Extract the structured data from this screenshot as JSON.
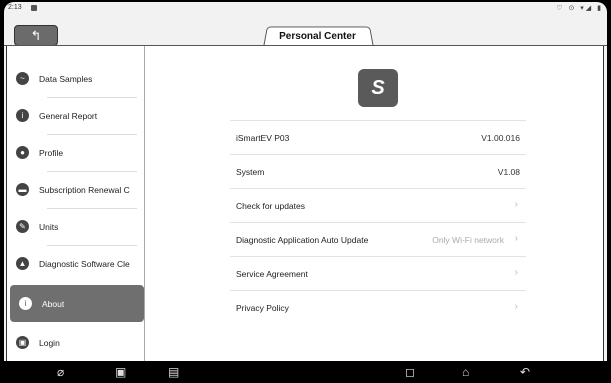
{
  "status": {
    "time": "2:13",
    "icons": "♡ ⊙ ▾◢ ▮"
  },
  "header": {
    "title": "Personal Center",
    "back_icon": "back-arrow-icon"
  },
  "sidebar": {
    "items": [
      {
        "label": "Data Samples",
        "icon": "waveform-icon",
        "active": false
      },
      {
        "label": "General Report",
        "icon": "info-icon",
        "active": false
      },
      {
        "label": "Profile",
        "icon": "user-icon",
        "active": false
      },
      {
        "label": "Subscription Renewal C",
        "icon": "card-icon",
        "active": false
      },
      {
        "label": "Units",
        "icon": "pencil-icon",
        "active": false
      },
      {
        "label": "Diagnostic Software Cle",
        "icon": "clean-icon",
        "active": false
      },
      {
        "label": "About",
        "icon": "info-icon",
        "active": true
      },
      {
        "label": "Login",
        "icon": "login-icon",
        "active": false
      }
    ]
  },
  "about": {
    "logo_letter": "S",
    "rows": [
      {
        "label": "iSmartEV P03",
        "value": "V1.00.016"
      },
      {
        "label": "System",
        "value": "V1.08"
      },
      {
        "label": "Check for updates",
        "value": ""
      },
      {
        "label": "Diagnostic Application Auto Update",
        "value": "Only Wi-Fi network"
      },
      {
        "label": "Service Agreement",
        "value": ""
      },
      {
        "label": "Privacy Policy",
        "value": ""
      }
    ]
  },
  "navbar": {
    "icons": [
      "browser-icon",
      "gallery-icon",
      "vci-icon",
      "recents-icon",
      "home-icon",
      "back-icon"
    ]
  }
}
